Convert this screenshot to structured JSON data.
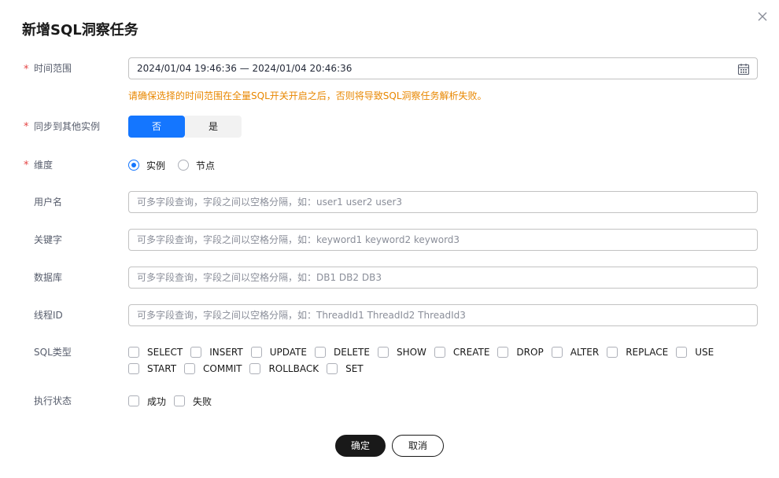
{
  "dialog": {
    "title": "新增SQL洞察任务",
    "close_icon": "close-icon"
  },
  "form": {
    "required_mark": "*",
    "time_range": {
      "label": "时间范围",
      "value": "2024/01/04 19:46:36 — 2024/01/04 20:46:36",
      "icon": "calendar-icon",
      "warning": "请确保选择的时间范围在全量SQL开关开启之后，否则将导致SQL洞察任务解析失败。"
    },
    "sync": {
      "label": "同步到其他实例",
      "options": [
        "否",
        "是"
      ],
      "selected": "否"
    },
    "dimension": {
      "label": "维度",
      "options": [
        "实例",
        "节点"
      ],
      "selected": "实例"
    },
    "username": {
      "label": "用户名",
      "placeholder": "可多字段查询，字段之间以空格分隔，如：user1 user2 user3"
    },
    "keyword": {
      "label": "关键字",
      "placeholder": "可多字段查询，字段之间以空格分隔，如：keyword1 keyword2 keyword3"
    },
    "database": {
      "label": "数据库",
      "placeholder": "可多字段查询，字段之间以空格分隔，如：DB1 DB2 DB3"
    },
    "thread": {
      "label": "线程ID",
      "placeholder": "可多字段查询，字段之间以空格分隔，如：ThreadId1 ThreadId2 ThreadId3"
    },
    "sql_type": {
      "label": "SQL类型",
      "options": [
        "SELECT",
        "INSERT",
        "UPDATE",
        "DELETE",
        "SHOW",
        "CREATE",
        "DROP",
        "ALTER",
        "REPLACE",
        "USE",
        "START",
        "COMMIT",
        "ROLLBACK",
        "SET"
      ]
    },
    "exec_status": {
      "label": "执行状态",
      "options": [
        "成功",
        "失败"
      ]
    }
  },
  "buttons": {
    "confirm": "确定",
    "cancel": "取消"
  },
  "colors": {
    "primary": "#1476ff",
    "warning": "#e88700",
    "required": "#e54545",
    "dark_button": "#191919"
  }
}
